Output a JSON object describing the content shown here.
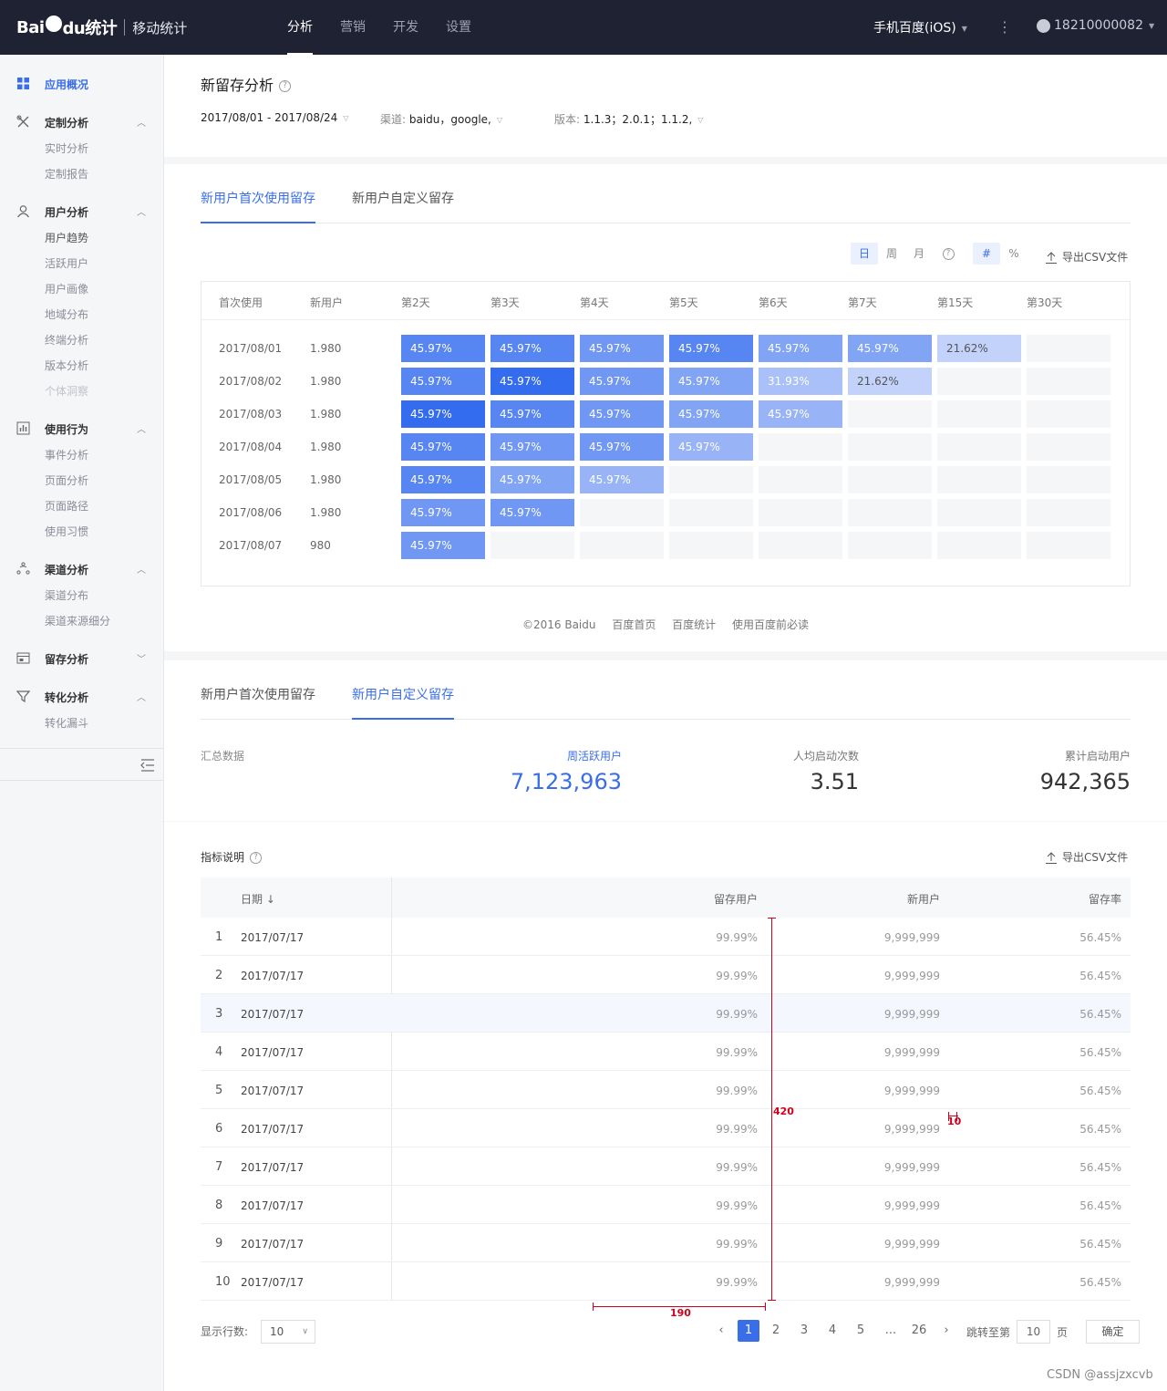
{
  "header": {
    "logo_text": "Bai",
    "logo_text2": "du统计",
    "logo_sub": "移动统计",
    "nav": [
      "分析",
      "营销",
      "开发",
      "设置"
    ],
    "active_nav": 0,
    "app_name": "手机百度(iOS)",
    "account": "18210000082"
  },
  "sidebar": {
    "groups": [
      {
        "label": "应用概况",
        "icon": "grid-icon",
        "active": true,
        "arrow": "",
        "items": []
      },
      {
        "label": "定制分析",
        "icon": "tools-icon",
        "arrow": "up",
        "items": [
          "实时分析",
          "定制报告"
        ]
      },
      {
        "label": "用户分析",
        "icon": "user-icon",
        "arrow": "up",
        "items": [
          "用户趋势",
          "活跃用户",
          "用户画像",
          "地域分布",
          "终端分析",
          "版本分析",
          "个体洞察"
        ]
      },
      {
        "label": "使用行为",
        "icon": "bar-chart-icon",
        "arrow": "up",
        "items": [
          "事件分析",
          "页面分析",
          "页面路径",
          "使用习惯"
        ]
      },
      {
        "label": "渠道分析",
        "icon": "channel-icon",
        "arrow": "up",
        "items": [
          "渠道分布",
          "渠道来源细分"
        ]
      },
      {
        "label": "留存分析",
        "icon": "retention-icon",
        "arrow": "down",
        "items": []
      },
      {
        "label": "转化分析",
        "icon": "funnel-icon",
        "arrow": "up",
        "items": [
          "转化漏斗"
        ]
      }
    ]
  },
  "overview": {
    "title": "新留存分析",
    "date_range": "2017/08/01 - 2017/08/24",
    "channel_label": "渠道:",
    "channel_value": "baidu，google,",
    "version_label": "版本:",
    "version_value": "1.1.3；2.0.1；1.1.2,"
  },
  "retention": {
    "tabs": [
      "新用户首次使用留存",
      "新用户自定义留存"
    ],
    "period_options": [
      "日",
      "周",
      "月"
    ],
    "mode_options": [
      "#",
      "%"
    ],
    "export_label": "导出CSV文件",
    "columns": [
      "首次使用",
      "新用户",
      "第2天",
      "第3天",
      "第4天",
      "第5天",
      "第6天",
      "第7天",
      "第15天",
      "第30天"
    ],
    "rows": [
      {
        "date": "2017/08/01",
        "new": "1.980",
        "cells": [
          [
            "45.97%",
            0.8
          ],
          [
            "45.97%",
            0.8
          ],
          [
            "45.97%",
            0.65
          ],
          [
            "45.97%",
            0.8
          ],
          [
            "45.97%",
            0.55
          ],
          [
            "45.97%",
            0.55
          ],
          [
            "21.62%",
            0.18
          ],
          [
            "",
            0
          ]
        ]
      },
      {
        "date": "2017/08/02",
        "new": "1.980",
        "cells": [
          [
            "45.97%",
            0.8
          ],
          [
            "45.97%",
            1.0
          ],
          [
            "45.97%",
            0.65
          ],
          [
            "45.97%",
            0.55
          ],
          [
            "31.93%",
            0.32
          ],
          [
            "21.62%",
            0.18
          ],
          [
            "",
            0
          ],
          [
            "",
            0
          ]
        ]
      },
      {
        "date": "2017/08/03",
        "new": "1.980",
        "cells": [
          [
            "45.97%",
            1.0
          ],
          [
            "45.97%",
            0.8
          ],
          [
            "45.97%",
            0.65
          ],
          [
            "45.97%",
            0.55
          ],
          [
            "45.97%",
            0.42
          ],
          [
            "",
            0
          ],
          [
            "",
            0
          ],
          [
            "",
            0
          ]
        ]
      },
      {
        "date": "2017/08/04",
        "new": "1.980",
        "cells": [
          [
            "45.97%",
            0.8
          ],
          [
            "45.97%",
            0.65
          ],
          [
            "45.97%",
            0.65
          ],
          [
            "45.97%",
            0.42
          ],
          [
            "",
            0
          ],
          [
            "",
            0
          ],
          [
            "",
            0
          ],
          [
            "",
            0
          ]
        ]
      },
      {
        "date": "2017/08/05",
        "new": "1.980",
        "cells": [
          [
            "45.97%",
            0.8
          ],
          [
            "45.97%",
            0.55
          ],
          [
            "45.97%",
            0.42
          ],
          [
            "",
            0
          ],
          [
            "",
            0
          ],
          [
            "",
            0
          ],
          [
            "",
            0
          ],
          [
            "",
            0
          ]
        ]
      },
      {
        "date": "2017/08/06",
        "new": "1.980",
        "cells": [
          [
            "45.97%",
            0.65
          ],
          [
            "45.97%",
            0.65
          ],
          [
            "",
            0
          ],
          [
            "",
            0
          ],
          [
            "",
            0
          ],
          [
            "",
            0
          ],
          [
            "",
            0
          ],
          [
            "",
            0
          ]
        ]
      },
      {
        "date": "2017/08/07",
        "new": "980",
        "cells": [
          [
            "45.97%",
            0.65
          ],
          [
            "",
            0
          ],
          [
            "",
            0
          ],
          [
            "",
            0
          ],
          [
            "",
            0
          ],
          [
            "",
            0
          ],
          [
            "",
            0
          ],
          [
            "",
            0
          ]
        ]
      }
    ]
  },
  "footer": {
    "links": [
      "©2016 Baidu",
      "百度首页",
      "百度统计",
      "使用百度前必读"
    ]
  },
  "custom": {
    "tabs": [
      "新用户首次使用留存",
      "新用户自定义留存"
    ],
    "summary_label": "汇总数据",
    "metrics": [
      {
        "label": "周活跃用户",
        "value": "7,123,963"
      },
      {
        "label": "人均启动次数",
        "value": "3.51"
      },
      {
        "label": "累计启动用户",
        "value": "942,365"
      }
    ]
  },
  "table": {
    "title": "指标说明",
    "export_label": "导出CSV文件",
    "headers": [
      "日期",
      "留存用户",
      "新用户",
      "留存率"
    ],
    "sort_arrow": "↓",
    "rows": [
      [
        "1",
        "2017/07/17",
        "99.99%",
        "9,999,999",
        "56.45%"
      ],
      [
        "2",
        "2017/07/17",
        "99.99%",
        "9,999,999",
        "56.45%"
      ],
      [
        "3",
        "2017/07/17",
        "99.99%",
        "9,999,999",
        "56.45%"
      ],
      [
        "4",
        "2017/07/17",
        "99.99%",
        "9,999,999",
        "56.45%"
      ],
      [
        "5",
        "2017/07/17",
        "99.99%",
        "9,999,999",
        "56.45%"
      ],
      [
        "6",
        "2017/07/17",
        "99.99%",
        "9,999,999",
        "56.45%"
      ],
      [
        "7",
        "2017/07/17",
        "99.99%",
        "9,999,999",
        "56.45%"
      ],
      [
        "8",
        "2017/07/17",
        "99.99%",
        "9,999,999",
        "56.45%"
      ],
      [
        "9",
        "2017/07/17",
        "99.99%",
        "9,999,999",
        "56.45%"
      ],
      [
        "10",
        "2017/07/17",
        "99.99%",
        "9,999,999",
        "56.45%"
      ]
    ],
    "highlight_row": 2,
    "annotations": {
      "vertical": "420",
      "horizontal": "190",
      "small": "10"
    }
  },
  "pager": {
    "rows_label": "显示行数:",
    "rows_value": "10",
    "prev": "‹",
    "next": "›",
    "pages": [
      "1",
      "2",
      "3",
      "4",
      "5",
      "...",
      "26"
    ],
    "current": 0,
    "jump_label": "跳转至第",
    "jump_value": "10",
    "jump_unit": "页",
    "confirm": "确定"
  },
  "watermark": "CSDN @assjzxcvb",
  "colors": {
    "accent": "#3a6ee8",
    "header_bg": "#1f2233",
    "annotation": "#d0021b"
  }
}
